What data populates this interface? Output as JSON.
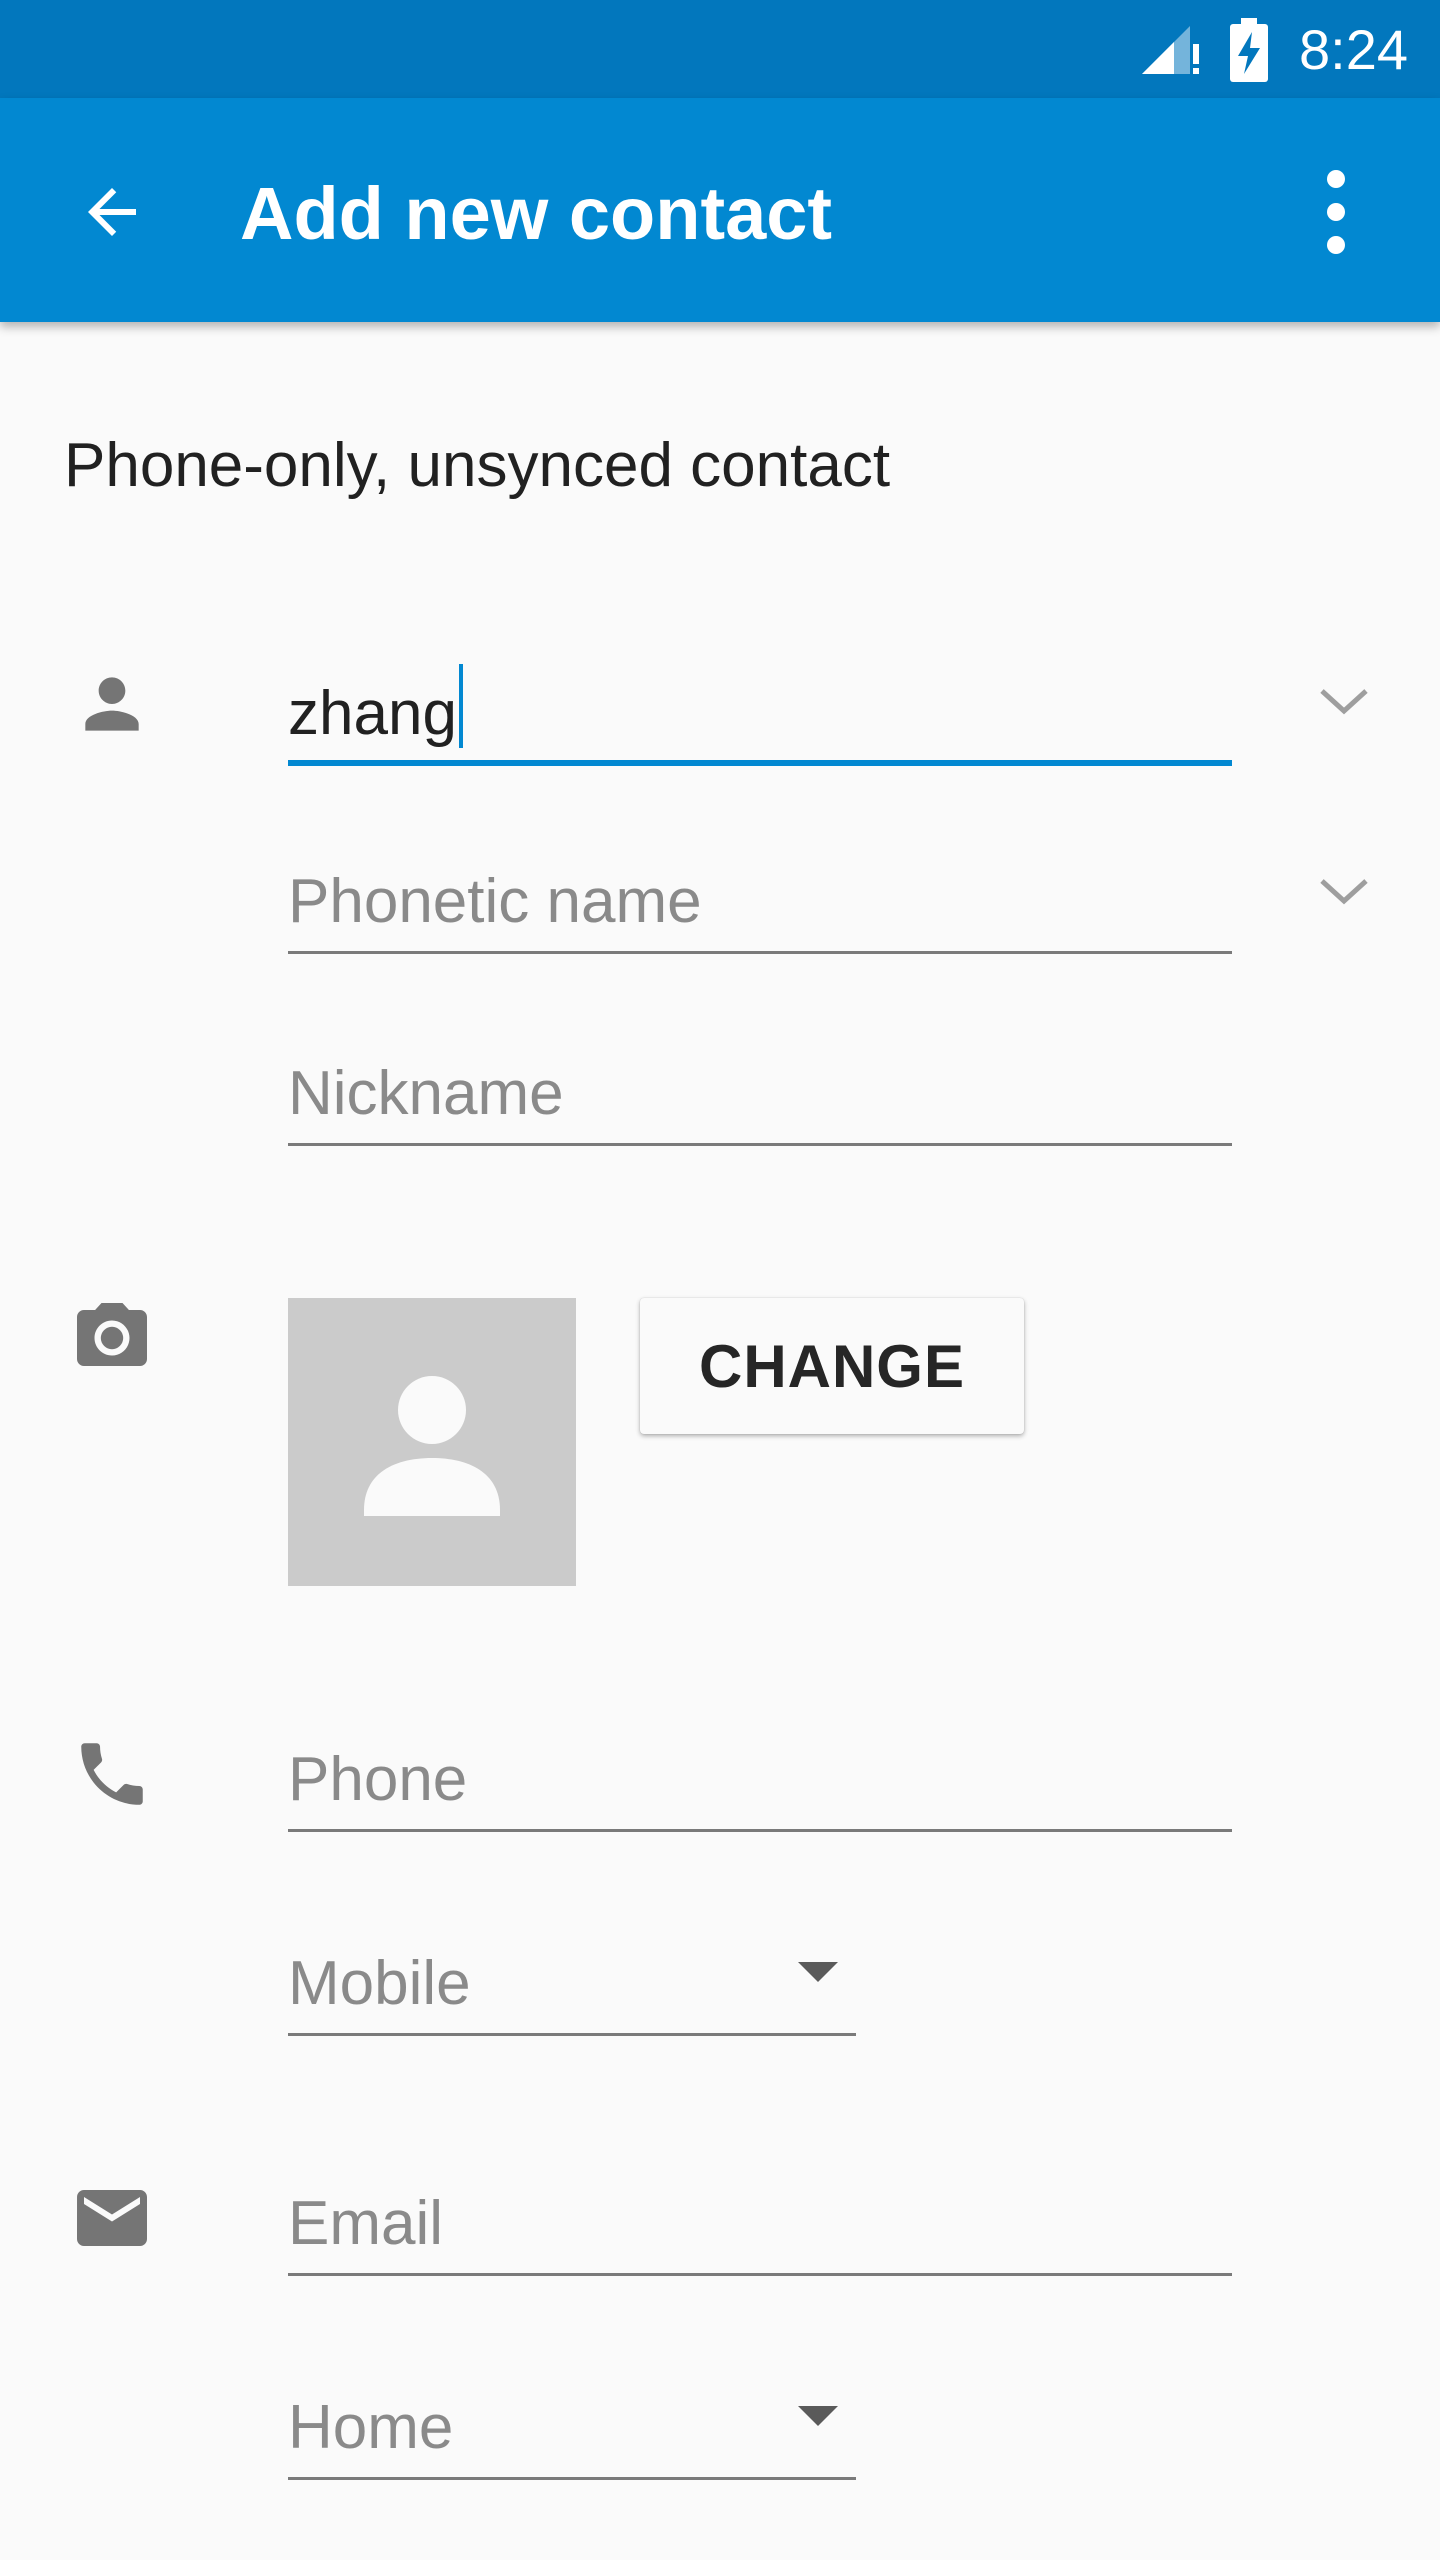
{
  "status_bar": {
    "time": "8:24",
    "icons": [
      "signal-warning-icon",
      "battery-charging-icon"
    ]
  },
  "app_bar": {
    "title": "Add new contact",
    "icons": [
      "arrow-back-icon",
      "more-vert-icon"
    ],
    "background_color": "#0288d1",
    "status_color": "#0277bd"
  },
  "account": {
    "label": "Phone-only, unsynced contact"
  },
  "name_section": {
    "icon": "person-icon",
    "name_value": "zhang",
    "phonetic_placeholder": "Phonetic name",
    "nickname_placeholder": "Nickname",
    "expand_icon": "chevron-down-icon"
  },
  "photo_section": {
    "icon": "camera-icon",
    "change_label": "CHANGE",
    "placeholder_icon": "person-icon"
  },
  "phone_section": {
    "icon": "phone-icon",
    "placeholder": "Phone",
    "type_selected": "Mobile"
  },
  "email_section": {
    "icon": "email-icon",
    "placeholder": "Email",
    "type_selected": "Home"
  },
  "colors": {
    "accent": "#0288d1",
    "placeholder_text": "#8a8a8a",
    "icon": "#757575"
  }
}
